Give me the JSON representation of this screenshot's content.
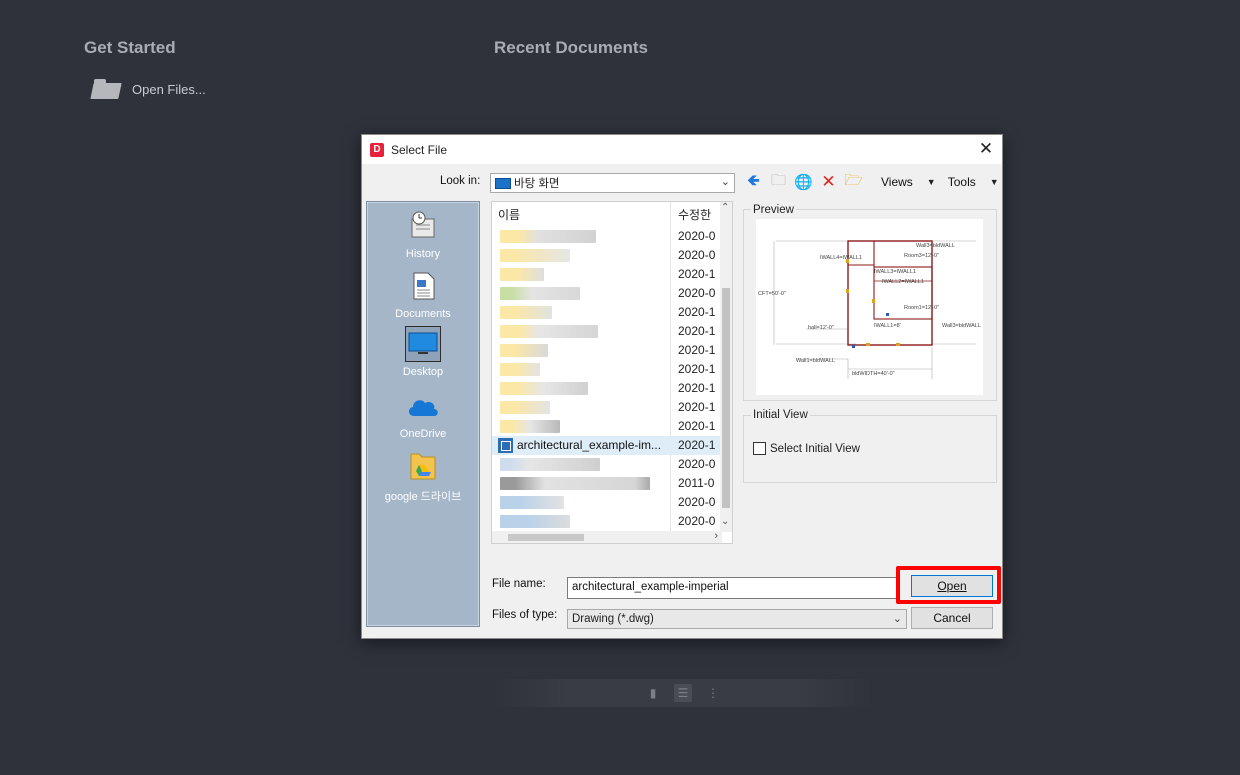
{
  "background": {
    "get_started": "Get Started",
    "recent_documents": "Recent Documents",
    "open_files": "Open Files..."
  },
  "dialog": {
    "title": "Select File",
    "app_icon_letter": "D",
    "close": "✕",
    "look_in_label": "Look in:",
    "look_in_value": "바탕 화면",
    "toolbar": {
      "views": "Views",
      "tools": "Tools"
    },
    "places": [
      {
        "label": "History",
        "icon": "history-icon"
      },
      {
        "label": "Documents",
        "icon": "documents-icon"
      },
      {
        "label": "Desktop",
        "icon": "desktop-icon",
        "selected": true
      },
      {
        "label": "OneDrive",
        "icon": "onedrive-icon"
      },
      {
        "label": "google 드라이브",
        "icon": "google-drive-icon"
      }
    ],
    "file_list": {
      "col_name": "이름",
      "col_date": "수정한",
      "rows": [
        {
          "date": "2020-0"
        },
        {
          "date": "2020-0"
        },
        {
          "date": "2020-1"
        },
        {
          "date": "2020-0"
        },
        {
          "date": "2020-1"
        },
        {
          "date": "2020-1"
        },
        {
          "date": "2020-1"
        },
        {
          "date": "2020-1"
        },
        {
          "date": "2020-1"
        },
        {
          "date": "2020-1"
        },
        {
          "date": "2020-1"
        },
        {
          "name": "architectural_example-im...",
          "date": "2020-1",
          "selected": true
        },
        {
          "date": "2020-0"
        },
        {
          "date": "2011-0"
        },
        {
          "date": "2020-0"
        },
        {
          "date": "2020-0"
        }
      ]
    },
    "preview_label": "Preview",
    "initial_view_label": "Initial View",
    "select_initial_view": "Select Initial View",
    "file_name_label": "File name:",
    "file_name_value": "architectural_example-imperial",
    "files_of_type_label": "Files of type:",
    "files_of_type_value": "Drawing (*.dwg)",
    "open_button": "Open",
    "cancel_button": "Cancel"
  },
  "colors": {
    "background": "#2f323b",
    "dialog": "#f0f0f0",
    "highlight": "#ff0000",
    "places_bar": "#a5b6c9"
  }
}
